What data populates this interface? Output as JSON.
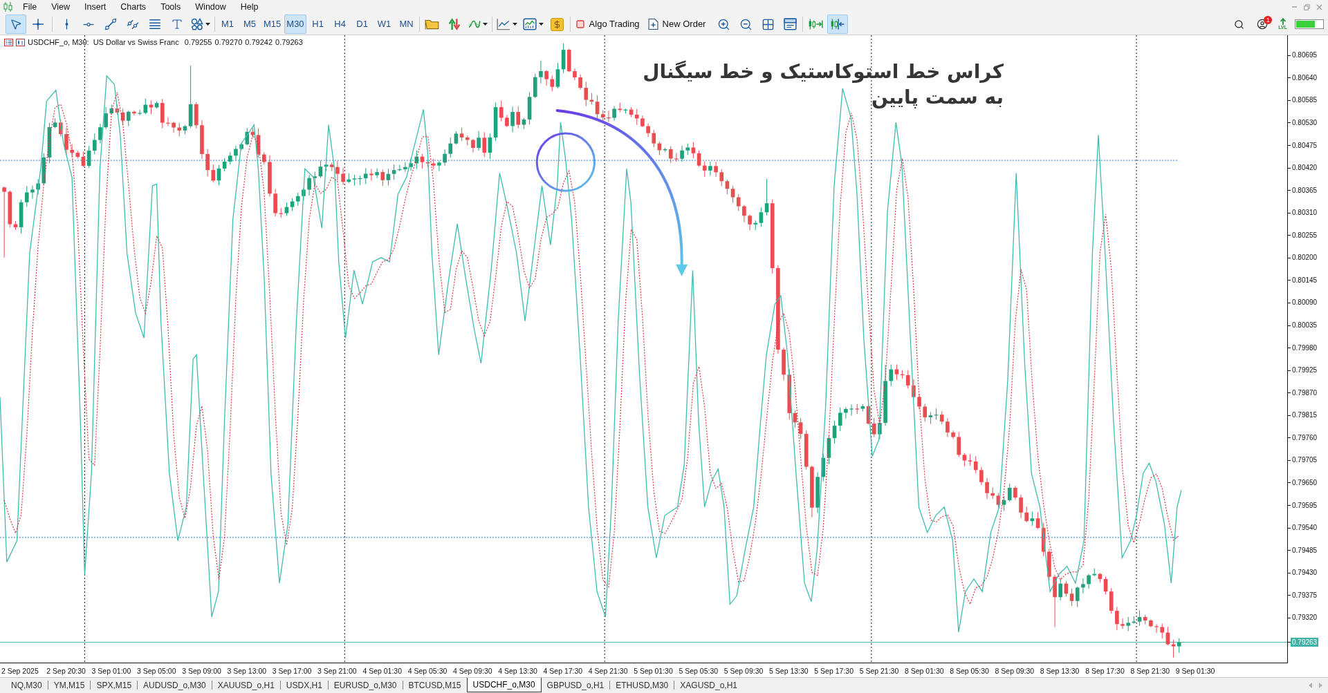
{
  "menu": [
    "File",
    "View",
    "Insert",
    "Charts",
    "Tools",
    "Window",
    "Help"
  ],
  "toolbar": {
    "drawing_tools": [
      {
        "kind": "cursor",
        "selected": true
      },
      {
        "kind": "crosshair",
        "selected": false
      },
      {
        "kind": "vertical-line",
        "selected": false
      },
      {
        "kind": "horizontal-line",
        "selected": false
      },
      {
        "kind": "trend-line",
        "selected": false
      },
      {
        "kind": "channel",
        "selected": false
      },
      {
        "kind": "fibonacci",
        "selected": false
      },
      {
        "kind": "text",
        "selected": false
      },
      {
        "kind": "shapes",
        "selected": false
      }
    ],
    "timeframes": [
      {
        "label": "M1",
        "selected": false
      },
      {
        "label": "M5",
        "selected": false
      },
      {
        "label": "M15",
        "selected": false
      },
      {
        "label": "M30",
        "selected": true
      },
      {
        "label": "H1",
        "selected": false
      },
      {
        "label": "H4",
        "selected": false
      },
      {
        "label": "D1",
        "selected": false
      },
      {
        "label": "W1",
        "selected": false
      },
      {
        "label": "MN",
        "selected": false
      }
    ],
    "algo_trading": {
      "label": "Algo Trading",
      "enabled": false
    },
    "new_order": {
      "label": "New Order"
    },
    "scroll_buttons": [
      {
        "kind": "shift",
        "selected": false
      },
      {
        "kind": "autoscroll",
        "selected": true
      }
    ],
    "notifications": {
      "count": "1"
    },
    "signal_label": "LVL"
  },
  "chart": {
    "symbol": "USDCHF_o, M30:",
    "description": "US Dollar vs Swiss Franc",
    "quotes": [
      "0.79255",
      "0.79270",
      "0.79242",
      "0.79263"
    ],
    "annotation": "کراس خط استوکاستیک و خط سیگنال به سمت پایین",
    "price_labels": [
      "0.80695",
      "0.80640",
      "0.80585",
      "0.80530",
      "0.80475",
      "0.80420",
      "0.80365",
      "0.80310",
      "0.80255",
      "0.80200",
      "0.80145",
      "0.80090",
      "0.80035",
      "0.79980",
      "0.79925",
      "0.79870",
      "0.79815",
      "0.79760",
      "0.79705",
      "0.79650",
      "0.79595",
      "0.79540",
      "0.79485",
      "0.79430",
      "0.79375",
      "0.79320"
    ],
    "current_price": "0.79263",
    "time_labels": [
      "2 Sep 2025",
      "2 Sep 20:30",
      "3 Sep 01:00",
      "3 Sep 05:00",
      "3 Sep 09:00",
      "3 Sep 13:00",
      "3 Sep 17:00",
      "3 Sep 21:00",
      "4 Sep 01:30",
      "4 Sep 05:30",
      "4 Sep 09:30",
      "4 Sep 13:30",
      "4 Sep 17:30",
      "4 Sep 21:30",
      "5 Sep 01:30",
      "5 Sep 05:30",
      "5 Sep 09:30",
      "5 Sep 13:30",
      "5 Sep 17:30",
      "5 Sep 21:30",
      "8 Sep 01:30",
      "8 Sep 05:30",
      "8 Sep 09:30",
      "8 Sep 13:30",
      "8 Sep 17:30",
      "8 Sep 21:30",
      "9 Sep 01:30"
    ]
  },
  "tabs": [
    {
      "label": "NQ,M30",
      "selected": false
    },
    {
      "label": "YM,M15",
      "selected": false
    },
    {
      "label": "SPX,M15",
      "selected": false
    },
    {
      "label": "AUDUSD_o,M30",
      "selected": false
    },
    {
      "label": "XAUUSD_o,H1",
      "selected": false
    },
    {
      "label": "USDX,H1",
      "selected": false
    },
    {
      "label": "EURUSD_o,M30",
      "selected": false
    },
    {
      "label": "BTCUSD,M15",
      "selected": false
    },
    {
      "label": "USDCHF_o,M30",
      "selected": true
    },
    {
      "label": "GBPUSD_o,H1",
      "selected": false
    },
    {
      "label": "ETHUSD,M30",
      "selected": false
    },
    {
      "label": "XAGUSD_o,H1",
      "selected": false
    }
  ]
}
